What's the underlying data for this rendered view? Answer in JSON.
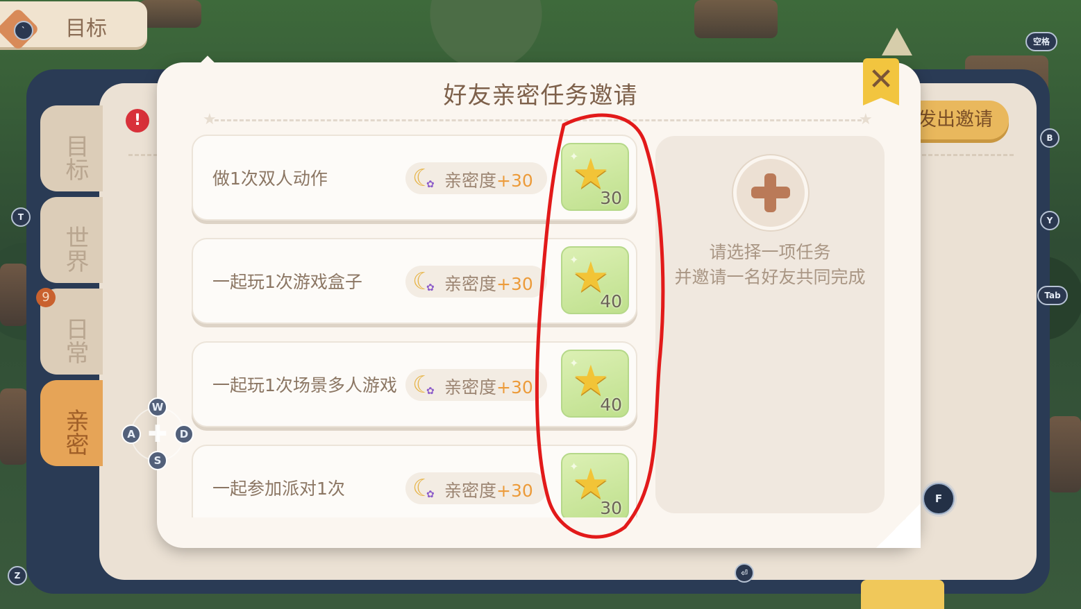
{
  "top_tab": {
    "label": "目标"
  },
  "side_tabs": [
    {
      "label": "目标"
    },
    {
      "label": "世界"
    },
    {
      "label": "日常",
      "badge": "9"
    },
    {
      "label": "亲密"
    }
  ],
  "back_panel": {
    "invite_button": "发出邀请"
  },
  "dialog": {
    "title": "好友亲密任务邀请",
    "close_symbol": "✕",
    "tasks": [
      {
        "name": "做1次双人动作",
        "affinity_label": "亲密度",
        "affinity_bonus": "+30",
        "reward_count": "30"
      },
      {
        "name": "一起玩1次游戏盒子",
        "affinity_label": "亲密度",
        "affinity_bonus": "+30",
        "reward_count": "40"
      },
      {
        "name": "一起玩1次场景多人游戏",
        "affinity_label": "亲密度",
        "affinity_bonus": "+30",
        "reward_count": "40"
      },
      {
        "name": "一起参加派对1次",
        "affinity_label": "亲密度",
        "affinity_bonus": "+30",
        "reward_count": "30"
      }
    ],
    "select_hint_line1": "请选择一项任务",
    "select_hint_line2": "并邀请一名好友共同完成"
  },
  "key_hints": {
    "space": "空格",
    "b": "B",
    "t": "T",
    "y": "Y",
    "tab": "Tab",
    "z": "Z",
    "enter": "⏎",
    "f": "F",
    "w": "W",
    "a": "A",
    "s": "S",
    "d": "D"
  },
  "icons": {
    "close": "close-icon",
    "add": "plus-icon",
    "reward": "star-icon",
    "affinity": "moon-icon",
    "warning": "exclamation-icon"
  },
  "colors": {
    "annotation": "#e21a1a",
    "accent": "#ec9b3a",
    "reward_bg": "#cde8a0"
  }
}
